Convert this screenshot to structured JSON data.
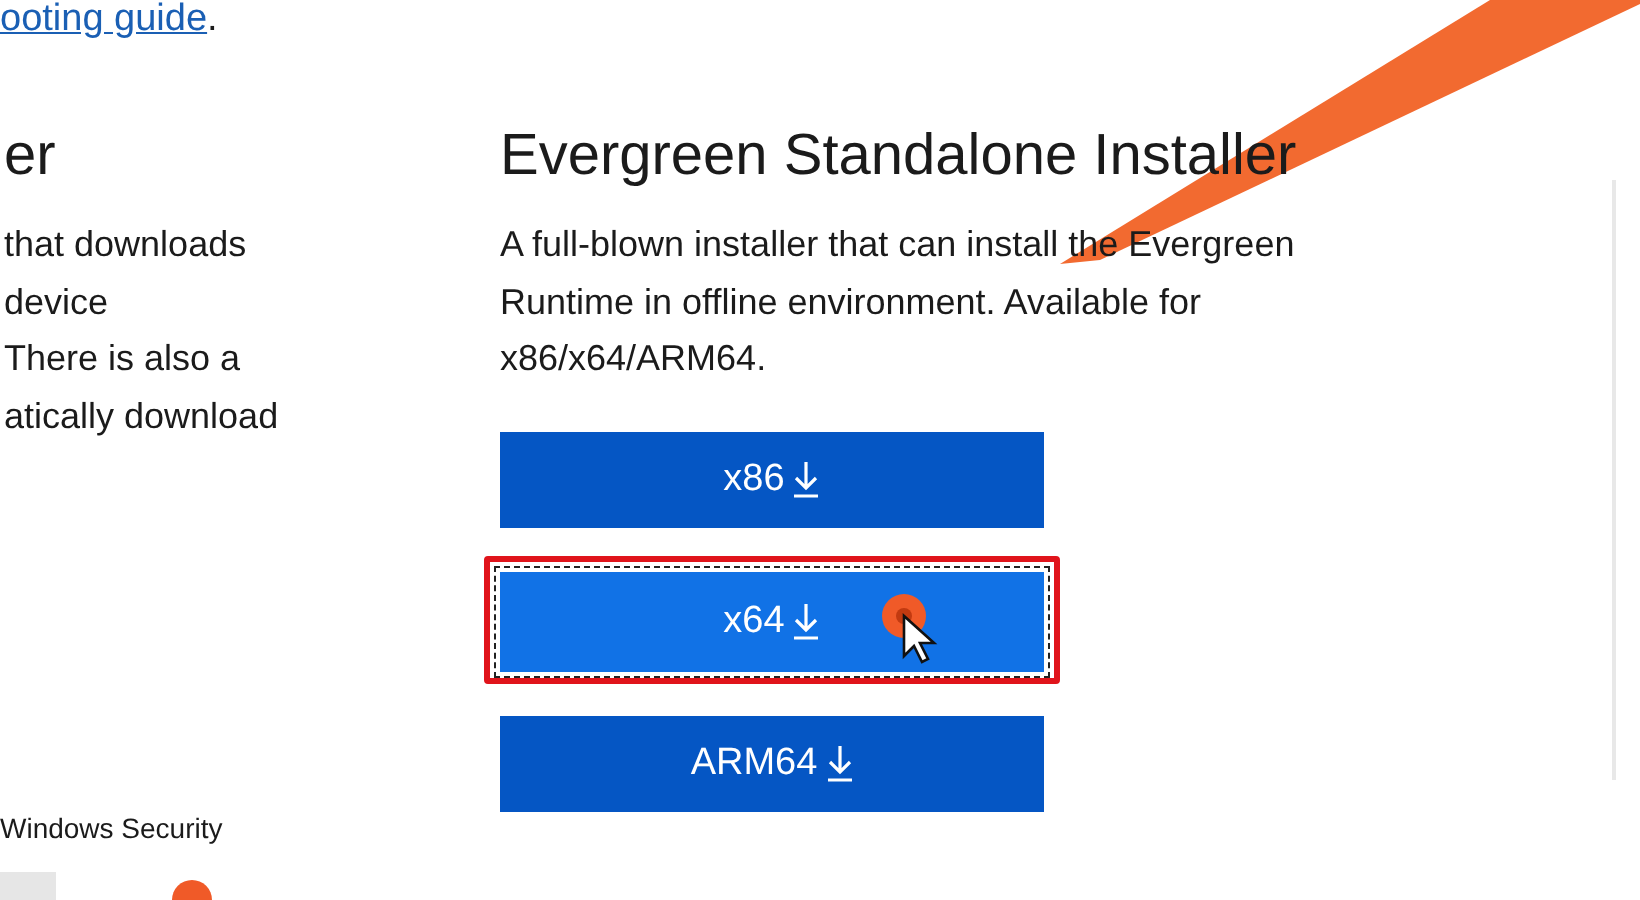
{
  "top_link": {
    "text": "ooting guide",
    "suffix": "."
  },
  "left_section": {
    "title": "er",
    "description_lines": [
      "that downloads",
      "device",
      "There is also a",
      "atically download"
    ]
  },
  "right_section": {
    "title": "Evergreen Standalone Installer",
    "description_lines": [
      "A full-blown installer that can install the Evergreen",
      "Runtime in offline environment. Available for",
      "x86/x64/ARM64."
    ],
    "buttons": [
      {
        "label": "x86",
        "highlighted": false
      },
      {
        "label": "x64",
        "highlighted": true
      },
      {
        "label": "ARM64",
        "highlighted": false
      }
    ]
  },
  "footer": {
    "label": "Windows Security"
  }
}
